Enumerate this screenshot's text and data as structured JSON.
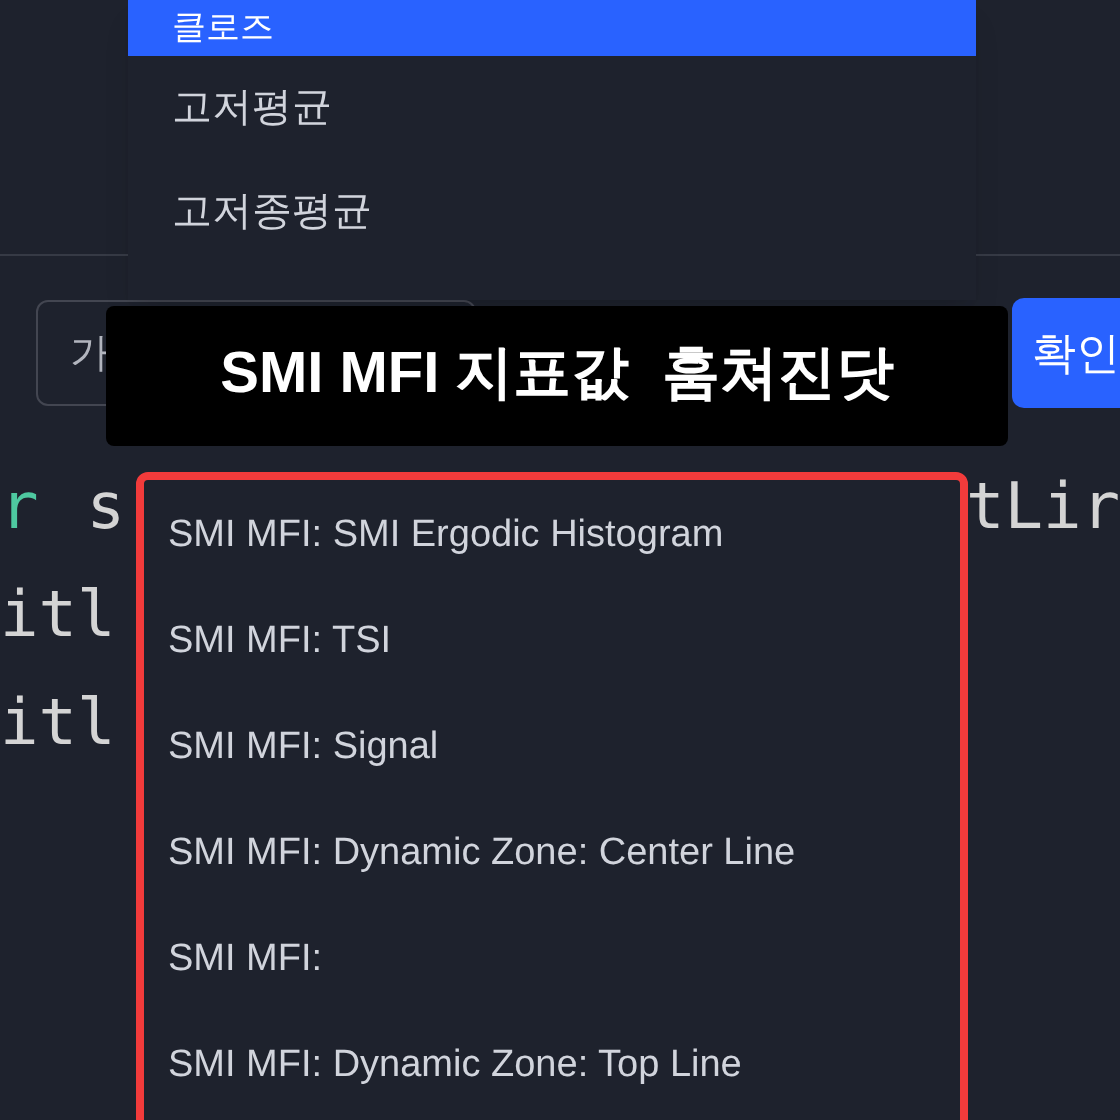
{
  "top_dropdown": {
    "items": [
      {
        "label": "클로즈",
        "selected": true
      },
      {
        "label": "고저평균",
        "selected": false
      },
      {
        "label": "고저종평균",
        "selected": false
      }
    ]
  },
  "input": {
    "value": "가"
  },
  "confirm_button": "확인",
  "caption": "SMI MFI 지표값  훔쳐진닷",
  "code_lines": [
    {
      "tokens": [
        {
          "text": "r",
          "kind": "keyword"
        },
        {
          "text": "s",
          "kind": "plain"
        }
      ],
      "right": "tLir"
    },
    {
      "tokens": [
        {
          "text": "itl",
          "kind": "plain"
        }
      ]
    },
    {
      "tokens": [
        {
          "text": "itl",
          "kind": "plain"
        }
      ]
    }
  ],
  "suggest_dropdown": {
    "items": [
      "SMI MFI: SMI Ergodic Histogram",
      "SMI MFI: TSI",
      "SMI MFI: Signal",
      "SMI MFI: Dynamic Zone: Center Line",
      "SMI MFI:",
      "SMI MFI: Dynamic Zone: Top Line"
    ]
  }
}
